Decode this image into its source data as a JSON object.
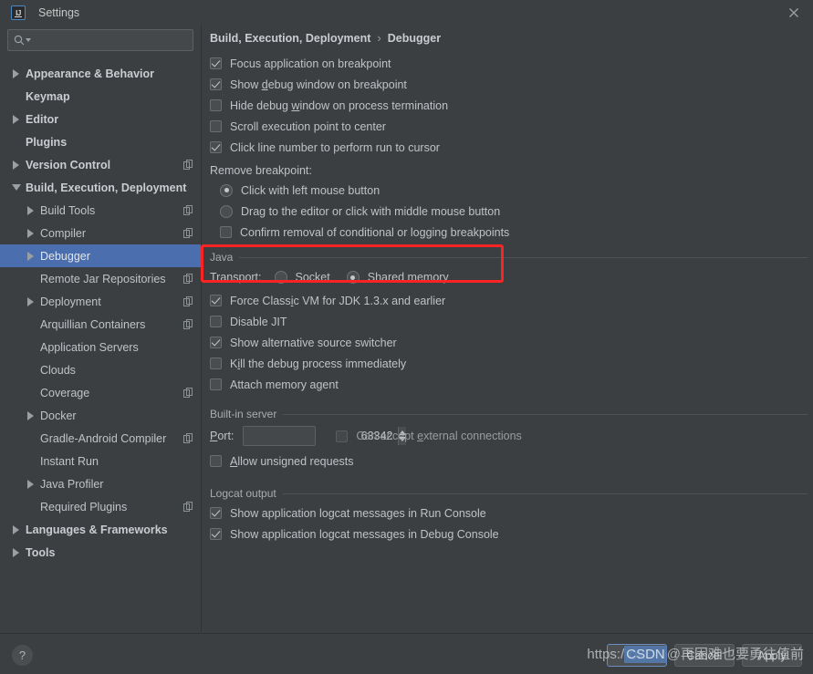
{
  "window": {
    "title": "Settings",
    "logo_icon": "intellij-idea-logo",
    "close_icon": "close-icon"
  },
  "sidebar": {
    "search": {
      "placeholder": "",
      "value": "",
      "icon": "search-icon",
      "caret_icon": "chevron-down-icon"
    },
    "items": [
      {
        "label": "Appearance & Behavior",
        "twisty": "right",
        "level": 0,
        "bold": true,
        "copy": false,
        "selected": false
      },
      {
        "label": "Keymap",
        "twisty": "none",
        "level": 0,
        "bold": true,
        "copy": false,
        "selected": false
      },
      {
        "label": "Editor",
        "twisty": "right",
        "level": 0,
        "bold": true,
        "copy": false,
        "selected": false
      },
      {
        "label": "Plugins",
        "twisty": "none",
        "level": 0,
        "bold": true,
        "copy": false,
        "selected": false
      },
      {
        "label": "Version Control",
        "twisty": "right",
        "level": 0,
        "bold": true,
        "copy": true,
        "selected": false
      },
      {
        "label": "Build, Execution, Deployment",
        "twisty": "down",
        "level": 0,
        "bold": true,
        "copy": false,
        "selected": false
      },
      {
        "label": "Build Tools",
        "twisty": "right",
        "level": 1,
        "bold": false,
        "copy": true,
        "selected": false
      },
      {
        "label": "Compiler",
        "twisty": "right",
        "level": 1,
        "bold": false,
        "copy": true,
        "selected": false
      },
      {
        "label": "Debugger",
        "twisty": "right",
        "level": 1,
        "bold": false,
        "copy": false,
        "selected": true
      },
      {
        "label": "Remote Jar Repositories",
        "twisty": "none",
        "level": 1,
        "bold": false,
        "copy": true,
        "selected": false
      },
      {
        "label": "Deployment",
        "twisty": "right",
        "level": 1,
        "bold": false,
        "copy": true,
        "selected": false
      },
      {
        "label": "Arquillian Containers",
        "twisty": "none",
        "level": 1,
        "bold": false,
        "copy": true,
        "selected": false
      },
      {
        "label": "Application Servers",
        "twisty": "none",
        "level": 1,
        "bold": false,
        "copy": false,
        "selected": false
      },
      {
        "label": "Clouds",
        "twisty": "none",
        "level": 1,
        "bold": false,
        "copy": false,
        "selected": false
      },
      {
        "label": "Coverage",
        "twisty": "none",
        "level": 1,
        "bold": false,
        "copy": true,
        "selected": false
      },
      {
        "label": "Docker",
        "twisty": "right",
        "level": 1,
        "bold": false,
        "copy": false,
        "selected": false
      },
      {
        "label": "Gradle-Android Compiler",
        "twisty": "none",
        "level": 1,
        "bold": false,
        "copy": true,
        "selected": false
      },
      {
        "label": "Instant Run",
        "twisty": "none",
        "level": 1,
        "bold": false,
        "copy": false,
        "selected": false
      },
      {
        "label": "Java Profiler",
        "twisty": "right",
        "level": 1,
        "bold": false,
        "copy": false,
        "selected": false
      },
      {
        "label": "Required Plugins",
        "twisty": "none",
        "level": 1,
        "bold": false,
        "copy": true,
        "selected": false
      },
      {
        "label": "Languages & Frameworks",
        "twisty": "right",
        "level": 0,
        "bold": true,
        "copy": false,
        "selected": false
      },
      {
        "label": "Tools",
        "twisty": "right",
        "level": 0,
        "bold": true,
        "copy": false,
        "selected": false
      }
    ]
  },
  "main": {
    "breadcrumb": {
      "root": "Build, Execution, Deployment",
      "separator": "›",
      "leaf": "Debugger"
    },
    "top_checkboxes": [
      {
        "label_pre": "Focus application on breakpoint",
        "mnemonic": "",
        "label_post": "",
        "checked": true
      },
      {
        "label_pre": "Show ",
        "mnemonic": "d",
        "label_post": "ebug window on breakpoint",
        "checked": true
      },
      {
        "label_pre": "Hide debug ",
        "mnemonic": "w",
        "label_post": "indow on process termination",
        "checked": false
      },
      {
        "label_pre": "Scroll execution point to center",
        "mnemonic": "",
        "label_post": "",
        "checked": false
      },
      {
        "label_pre": "Click line number to perform run to cursor",
        "mnemonic": "",
        "label_post": "",
        "checked": true
      }
    ],
    "remove_breakpoint": {
      "label": "Remove breakpoint:",
      "radios": [
        {
          "label": "Click with left mouse button",
          "checked": true
        },
        {
          "label": "Drag to the editor or click with middle mouse button",
          "checked": false
        }
      ],
      "confirm_checkbox": {
        "label": "Confirm removal of conditional or logging breakpoints",
        "checked": false
      }
    },
    "java_group": {
      "title": "Java",
      "transport_label": "Transport:",
      "options": [
        {
          "label_pre": "",
          "mnemonic": "S",
          "label_post": "ocket",
          "checked": false
        },
        {
          "label_pre": "Shared ",
          "mnemonic": "m",
          "label_post": "emory",
          "checked": true
        }
      ],
      "highlight_color": "#fb2323"
    },
    "java_checkboxes": [
      {
        "label_pre": "Force Class",
        "mnemonic": "i",
        "label_post": "c VM for JDK 1.3.x and earlier",
        "checked": true
      },
      {
        "label_pre": "Disable JIT",
        "mnemonic": "",
        "label_post": "",
        "checked": false
      },
      {
        "label_pre": "Show alternative source switcher",
        "mnemonic": "",
        "label_post": "",
        "checked": true
      },
      {
        "label_pre": "K",
        "mnemonic": "i",
        "label_post": "ll the debug process immediately",
        "checked": false
      },
      {
        "label_pre": "Attach memory agent",
        "mnemonic": "",
        "label_post": "",
        "checked": false
      }
    ],
    "builtin_server": {
      "title": "Built-in server",
      "port_label_pre": "",
      "port_label_mn": "P",
      "port_label_post": "ort:",
      "port_value": "63342",
      "spinner_up_icon": "spinner-up-icon",
      "spinner_down_icon": "spinner-down-icon",
      "external_cb": {
        "label_pre": "Can accept ",
        "mnemonic": "e",
        "label_post": "xternal connections",
        "checked": false,
        "disabled": true
      },
      "unsigned_cb": {
        "label_pre": "",
        "mnemonic": "A",
        "label_post": "llow unsigned requests",
        "checked": false
      }
    },
    "logcat": {
      "title": "Logcat output",
      "checkboxes": [
        {
          "label": "Show application logcat messages in Run Console",
          "checked": true
        },
        {
          "label": "Show application logcat messages in Debug Console",
          "checked": true
        }
      ]
    }
  },
  "footer": {
    "help_label": "?",
    "buttons": [
      {
        "label": "OK",
        "default": true
      },
      {
        "label": "Cancel",
        "default": false
      },
      {
        "label": "Apply",
        "default": false
      }
    ],
    "watermark_prefix": "https:/",
    "watermark_badge": "CSDN",
    "watermark_suffix": "@再困难也要勇往值前"
  }
}
